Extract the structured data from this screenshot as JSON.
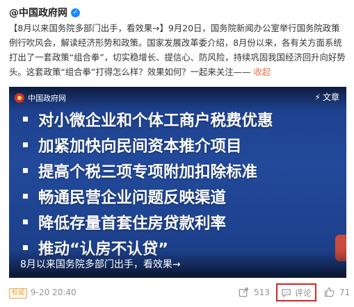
{
  "post": {
    "author": "@中国政府网",
    "text_main": "【8月以来国务院多部门出手，看效果→】9月20日，国务院新闻办公室举行国务院政策例行吹风会，解读经济形势和政策。国家发展改革委介绍，8月份以来，各有关方面系统打出了一套政策“组合拳”，切实稳增长、提信心、防风险，持续巩固我国经济回升向好势头。这套政策“组合拳”打得怎么样？效果如何？一起来关注—— ",
    "collapse_label": "收起"
  },
  "video": {
    "watermark": "中国政府网",
    "article_tag": "文章",
    "bullets": [
      "对小微企业和个体工商户税费优惠",
      "加紧加快向民间资本推介项目",
      "提高个税三项专项附加扣除标准",
      "畅通民营企业问题反映渠道",
      "降低存量首套住房贷款利率",
      "推动“认房不认贷”"
    ],
    "caption": "8月以来国务院多部门出手，看效果→"
  },
  "footer": {
    "badge": "权威",
    "timestamp": "9-20 20:40",
    "share_count": "513",
    "comment_label": "评论",
    "like_count": "71"
  }
}
